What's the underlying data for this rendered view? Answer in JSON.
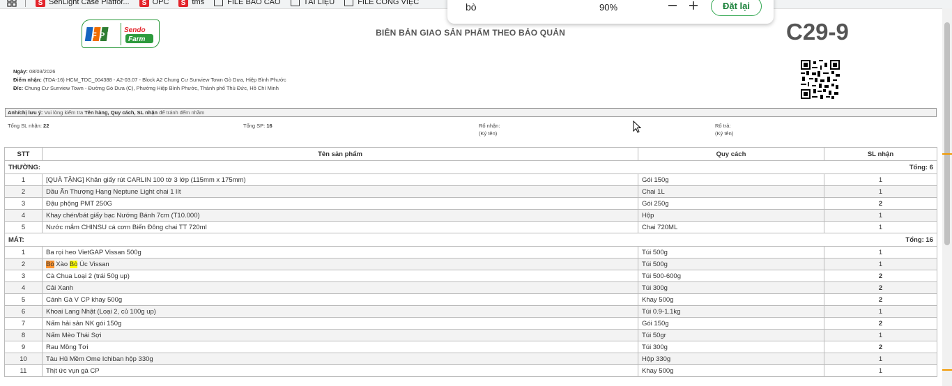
{
  "bookmarks": [
    {
      "label": "SenLight Case Platfor...",
      "icon": "sendo-favicon"
    },
    {
      "label": "OPC",
      "icon": "sendo-favicon"
    },
    {
      "label": "tms",
      "icon": "sendo-favicon"
    },
    {
      "label": "FILE BÁO CÁO",
      "icon": "folder-icon"
    },
    {
      "label": "TÀI LIỆU",
      "icon": "folder-icon"
    },
    {
      "label": "FILE CÔNG VIỆC",
      "icon": "folder-icon"
    }
  ],
  "find_bar": {
    "query": "bò",
    "zoom": "90%",
    "reset_label": "Đặt lại"
  },
  "doc": {
    "logo_left": "FPT",
    "logo_right_1": "Sendo",
    "logo_right_2": "Farm",
    "title": "BIÊN BẢN GIAO SẢN PHẨM THEO BẢO QUẢN",
    "code": "C29-9",
    "date_label": "Ngày:",
    "date_value": "08/03/2026",
    "pickup_label": "Điểm nhận:",
    "pickup_value": "(TDA-16) HCM_TDC_004388 - A2-03.07 - Block A2 Chung Cư Sunview Town Gò Dưa, Hiệp Bình Phước",
    "address_label": "Đ/c:",
    "address_value": "Chung Cư Sunview Town - Đường Gò Dưa (C), Phường Hiệp Bình Phước, Thành phố Thủ Đức, Hồ Chí Minh",
    "note_prefix": "Anh/chị lưu ý:",
    "note_text_1": "Vui lòng kiểm tra",
    "note_bold": "Tên hàng, Quy cách, SL nhận",
    "note_text_2": "để tránh đếm nhầm",
    "total_qty_label": "Tổng SL nhận:",
    "total_qty_value": "22",
    "total_sp_label": "Tổng SP:",
    "total_sp_value": "16",
    "basket_in_label": "Rổ nhận:",
    "basket_in_sign": "(Ký tên)",
    "basket_out_label": "Rổ trả:",
    "basket_out_sign": "(Ký tên)"
  },
  "table": {
    "headers": [
      "STT",
      "Tên sản phẩm",
      "Quy cách",
      "SL nhận"
    ],
    "groups": [
      {
        "name": "THƯỜNG:",
        "total": "Tổng: 6",
        "rows": [
          {
            "stt": "1",
            "name": "[QUÀ TẶNG] Khăn giấy rút CARLIN 100 tờ 3 lớp (115mm x 175mm)",
            "spec": "Gói 150g",
            "qty": "1"
          },
          {
            "stt": "2",
            "name": "Dầu Ăn Thượng Hạng Neptune Light chai 1 lít",
            "spec": "Chai 1L",
            "qty": "1"
          },
          {
            "stt": "3",
            "name": "Đậu phộng PMT 250G",
            "spec": "Gói 250g",
            "qty": "2"
          },
          {
            "stt": "4",
            "name": "Khay chén/bát giấy bạc Nướng Bánh 7cm (T10.000)",
            "spec": "Hộp",
            "qty": "1"
          },
          {
            "stt": "5",
            "name": "Nước mắm CHINSU cá cơm Biển Đông chai TT 720ml",
            "spec": "Chai 720ML",
            "qty": "1"
          }
        ]
      },
      {
        "name": "MÁT:",
        "total": "Tổng: 16",
        "rows": [
          {
            "stt": "1",
            "name": "Ba rọi heo VietGAP Vissan 500g",
            "spec": "Túi 500g",
            "qty": "1"
          },
          {
            "stt": "2",
            "name_parts": [
              "Bò",
              " Xào ",
              "Bò",
              " Úc Vissan"
            ],
            "spec": "Túi 500g",
            "qty": "1"
          },
          {
            "stt": "3",
            "name": "Cà Chua Loại 2 (trái 50g up)",
            "spec": "Túi 500-600g",
            "qty": "2"
          },
          {
            "stt": "4",
            "name": "Cải Xanh",
            "spec": "Túi 300g",
            "qty": "2"
          },
          {
            "stt": "5",
            "name": "Cánh Gà V CP khay 500g",
            "spec": "Khay 500g",
            "qty": "2"
          },
          {
            "stt": "6",
            "name": "Khoai Lang Nhật (Loại 2, củ 100g up)",
            "spec": "Túi 0.9-1.1kg",
            "qty": "1"
          },
          {
            "stt": "7",
            "name": "Nấm hải sản NK gói 150g",
            "spec": "Gói 150g",
            "qty": "2"
          },
          {
            "stt": "8",
            "name": "Nấm Mèo Thái Sợi",
            "spec": "Túi 50gr",
            "qty": "1"
          },
          {
            "stt": "9",
            "name": "Rau Mồng Tơi",
            "spec": "Túi 300g",
            "qty": "2"
          },
          {
            "stt": "10",
            "name": "Tàu Hũ Mềm Ome Ichiban hộp 330g",
            "spec": "Hộp 330g",
            "qty": "1"
          },
          {
            "stt": "11",
            "name": "Thịt ức vụn gà CP",
            "spec": "Khay 500g",
            "qty": "1"
          }
        ]
      }
    ]
  },
  "colors": {
    "find_match_active": "#ff9632",
    "find_match": "#ffff00",
    "reset_button": "#188038"
  }
}
